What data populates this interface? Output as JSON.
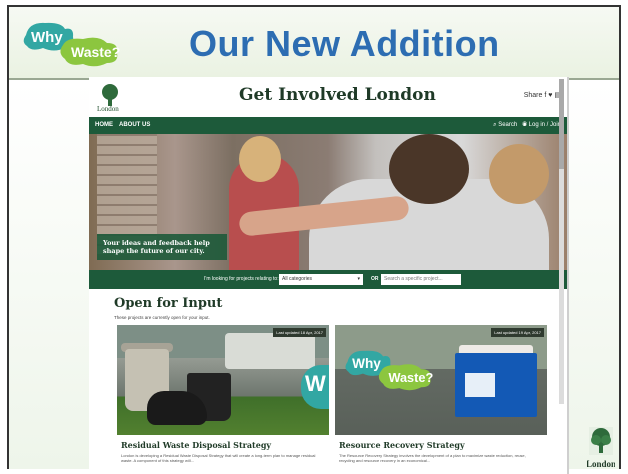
{
  "slide": {
    "title": "Our New Addition",
    "logo_text_1": "Why",
    "logo_text_2": "Waste?"
  },
  "website": {
    "brand": "London",
    "title": "Get Involved London",
    "share_label": "Share",
    "nav": [
      "HOME",
      "ABOUT US"
    ],
    "nav_right": [
      "Search",
      "Log in / Join"
    ],
    "hero_caption": "Your ideas and feedback help shape the future of our city.",
    "filter": {
      "label": "I'm looking for projects relating to:",
      "selected": "All categories",
      "or_label": "OR",
      "search_placeholder": "Search a specific project..."
    },
    "section_title": "Open for Input",
    "section_subtitle": "These projects are currently open for your input.",
    "cards": [
      {
        "badge": "Last updated 18 Apr, 2017",
        "title": "Residual Waste Disposal Strategy",
        "description": "London is developing a Residual Waste Disposal Strategy that will create a long-term plan to manage residual waste. A component of this strategy will...",
        "overlay_text": "W"
      },
      {
        "badge": "Last updated 19 Apr, 2017",
        "title": "Resource Recovery Strategy",
        "description": "The Resource Recovery Strategy involves the development of a plan to maximize waste reduction, reuse, recycling and resource recovery in an economical...",
        "logo_text_1": "Why",
        "logo_text_2": "Waste?"
      }
    ]
  },
  "colors": {
    "title_blue": "#2d6db2",
    "site_green": "#1d5a3a",
    "logo_teal": "#32a7a3",
    "logo_lime": "#8cc63f"
  },
  "icons": [
    "why-waste-logo",
    "london-tree-icon",
    "facebook-icon",
    "twitter-icon",
    "print-icon",
    "search-icon",
    "user-icon",
    "dropdown-icon"
  ],
  "footer_logo_text": "London"
}
